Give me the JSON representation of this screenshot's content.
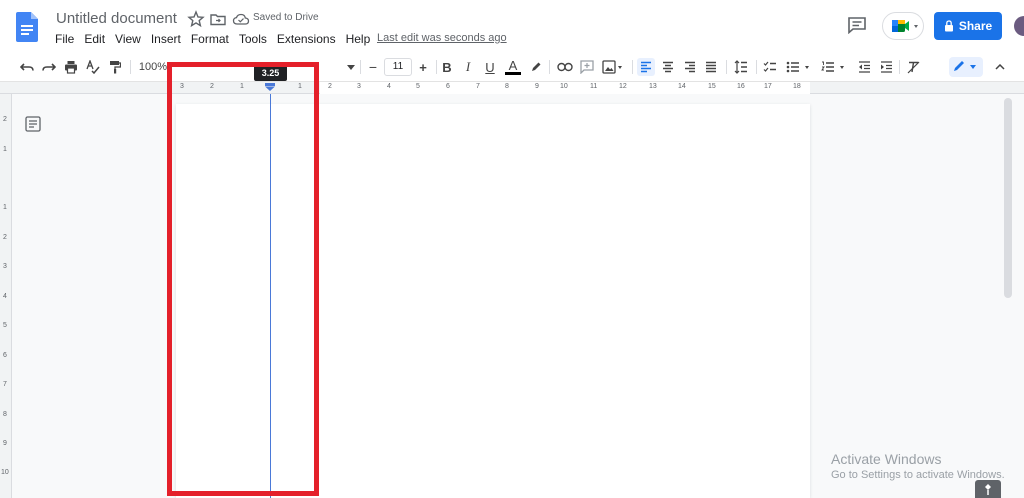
{
  "header": {
    "title": "Untitled document",
    "save_status": "Saved to Drive",
    "last_edit": "Last edit was seconds ago",
    "share_label": "Share"
  },
  "menu": {
    "items": [
      "File",
      "Edit",
      "View",
      "Insert",
      "Format",
      "Tools",
      "Extensions",
      "Help"
    ]
  },
  "toolbar": {
    "zoom": "100%",
    "font_size": "11",
    "decrease": "−",
    "increase": "+",
    "bold": "B",
    "italic": "I",
    "underline": "U",
    "text_color": "A"
  },
  "ruler": {
    "tooltip": "3.25",
    "h_numbers": [
      "3",
      "2",
      "1",
      "1",
      "2",
      "3",
      "4",
      "5",
      "6",
      "7",
      "8",
      "9",
      "10",
      "11",
      "12",
      "13",
      "14",
      "15",
      "16",
      "17",
      "18"
    ],
    "v_numbers": [
      "2",
      "1",
      "1",
      "2",
      "3",
      "4",
      "5",
      "6",
      "7",
      "8",
      "9",
      "10"
    ]
  },
  "watermark": {
    "line1": "Activate Windows",
    "line2": "Go to Settings to activate Windows."
  },
  "icons": {
    "docs_logo": "docs-logo-icon",
    "star": "star-icon",
    "move": "folder-move-icon",
    "cloud": "cloud-check-icon",
    "comments": "comment-icon",
    "meet": "meet-icon",
    "lock": "lock-icon",
    "outline": "document-outline-icon"
  },
  "colors": {
    "accent": "#1a73e8",
    "highlight": "#e4202a",
    "guide": "#4a79d8"
  }
}
